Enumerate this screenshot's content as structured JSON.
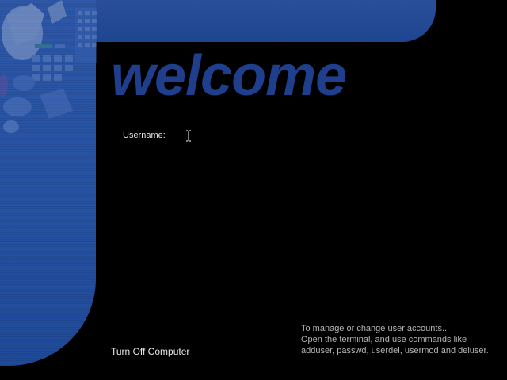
{
  "login": {
    "title": "welcome",
    "username_label": "Username:",
    "username_value": "",
    "username_placeholder": ""
  },
  "footer": {
    "turn_off_label": "Turn Off Computer",
    "help_lines": [
      "To manage or change user accounts...",
      "Open the terminal, and use commands like",
      "adduser, passwd, userdel, usermod and deluser."
    ]
  },
  "colors": {
    "background": "#000000",
    "band_blue": "#2652a2",
    "title_blue": "#1f3f8c",
    "label_text": "#e6e6e6",
    "help_text": "#b4b4b4"
  },
  "icons": {
    "cursor": "text-cursor-icon",
    "artwork": "decorative-artwork"
  }
}
